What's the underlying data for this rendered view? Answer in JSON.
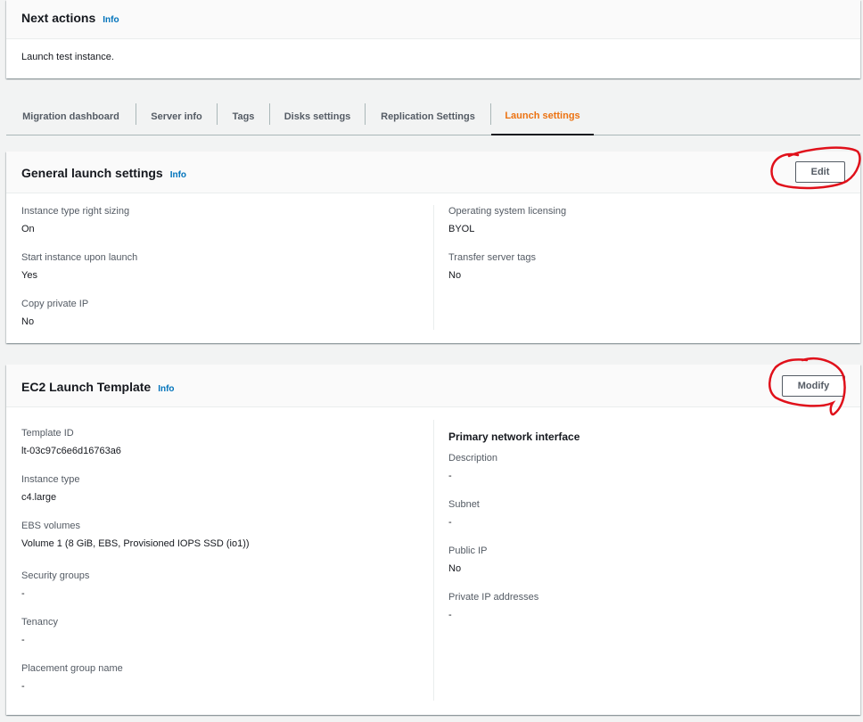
{
  "next_actions": {
    "title": "Next actions",
    "info": "Info",
    "text": "Launch test instance."
  },
  "tabs": [
    {
      "label": "Migration dashboard",
      "active": false
    },
    {
      "label": "Server info",
      "active": false
    },
    {
      "label": "Tags",
      "active": false
    },
    {
      "label": "Disks settings",
      "active": false
    },
    {
      "label": "Replication Settings",
      "active": false
    },
    {
      "label": "Launch settings",
      "active": true
    }
  ],
  "general_launch": {
    "title": "General launch settings",
    "info": "Info",
    "edit_label": "Edit",
    "left": [
      {
        "label": "Instance type right sizing",
        "value": "On"
      },
      {
        "label": "Start instance upon launch",
        "value": "Yes"
      },
      {
        "label": "Copy private IP",
        "value": "No"
      }
    ],
    "right": [
      {
        "label": "Operating system licensing",
        "value": "BYOL"
      },
      {
        "label": "Transfer server tags",
        "value": "No"
      }
    ]
  },
  "ec2_template": {
    "title": "EC2 Launch Template",
    "info": "Info",
    "modify_label": "Modify",
    "left": [
      {
        "label": "Template ID",
        "value": "lt-03c97c6e6d16763a6"
      },
      {
        "label": "Instance type",
        "value": "c4.large"
      },
      {
        "label": "EBS volumes",
        "value": "Volume 1 (8 GiB, EBS, Provisioned IOPS SSD (io1))"
      },
      {
        "label": "Security groups",
        "value": "-"
      },
      {
        "label": "Tenancy",
        "value": "-"
      },
      {
        "label": "Placement group name",
        "value": "-"
      }
    ],
    "right_heading": "Primary network interface",
    "right": [
      {
        "label": "Description",
        "value": "-"
      },
      {
        "label": "Subnet",
        "value": "-"
      },
      {
        "label": "Public IP",
        "value": "No"
      },
      {
        "label": "Private IP addresses",
        "value": "-"
      }
    ]
  },
  "colors": {
    "active_tab": "#ec7211",
    "info_link": "#0073bb",
    "annotation": "#e0101a"
  }
}
